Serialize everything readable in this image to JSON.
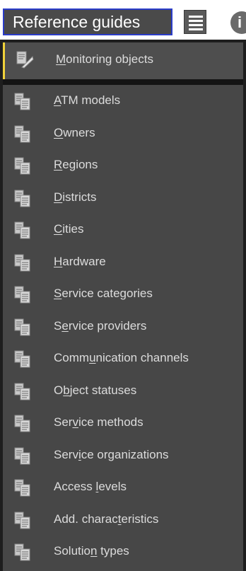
{
  "toolbar": {
    "menu_label": "Reference guides",
    "list_icon": "list-icon",
    "info_icon": "info-icon"
  },
  "menu": {
    "first_item": {
      "label": "Monitoring objects",
      "mnemonic_index": 0,
      "icon": "monitoring-objects-icon"
    },
    "items": [
      {
        "label": "ATM models",
        "mnemonic_index": 0,
        "icon": "document-copy-icon"
      },
      {
        "label": "Owners",
        "mnemonic_index": 0,
        "icon": "document-copy-icon"
      },
      {
        "label": "Regions",
        "mnemonic_index": 0,
        "icon": "document-copy-icon"
      },
      {
        "label": "Districts",
        "mnemonic_index": 0,
        "icon": "document-copy-icon"
      },
      {
        "label": "Cities",
        "mnemonic_index": 0,
        "icon": "document-copy-icon"
      },
      {
        "label": "Hardware",
        "mnemonic_index": 0,
        "icon": "document-copy-icon"
      },
      {
        "label": "Service categories",
        "mnemonic_index": 0,
        "icon": "document-copy-icon"
      },
      {
        "label": "Service providers",
        "mnemonic_index": 1,
        "icon": "document-copy-icon"
      },
      {
        "label": "Communication channels",
        "mnemonic_index": 4,
        "icon": "document-copy-icon"
      },
      {
        "label": "Object statuses",
        "mnemonic_index": 1,
        "icon": "document-copy-icon"
      },
      {
        "label": "Service methods",
        "mnemonic_index": 3,
        "icon": "document-copy-icon"
      },
      {
        "label": "Service organizations",
        "mnemonic_index": 4,
        "icon": "document-copy-icon"
      },
      {
        "label": "Access levels",
        "mnemonic_index": 7,
        "icon": "document-copy-icon"
      },
      {
        "label": "Add. characteristics",
        "mnemonic_index": 11,
        "icon": "document-copy-icon"
      },
      {
        "label": "Solution types",
        "mnemonic_index": 7,
        "icon": "document-copy-icon"
      }
    ]
  },
  "colors": {
    "menu_bg": "#474747",
    "text": "#dcdcdc",
    "highlight_bar": "#f0d23a",
    "button_border": "#2a3cc8"
  }
}
